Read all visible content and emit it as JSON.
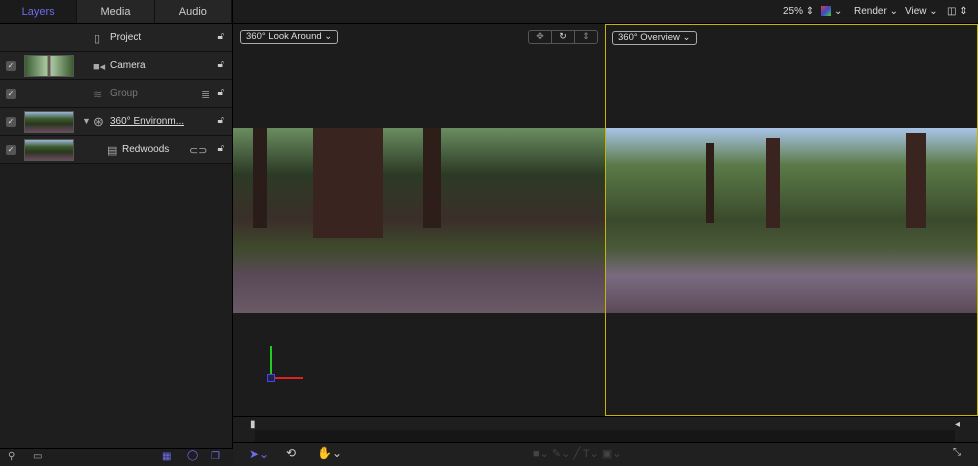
{
  "tabs": [
    "Layers",
    "Media",
    "Audio"
  ],
  "layers": [
    {
      "name": "Project",
      "icon": "document-icon"
    },
    {
      "name": "Camera",
      "icon": "camera-icon",
      "checked": true
    },
    {
      "name": "Group",
      "icon": "group-icon",
      "checked": true
    },
    {
      "name": "360° Environm...",
      "icon": "environment-icon",
      "checked": true
    },
    {
      "name": "Redwoods",
      "icon": "film-icon",
      "checked": true
    }
  ],
  "topbar": {
    "zoom": "25%",
    "render": "Render",
    "view": "View"
  },
  "viewers": {
    "left": "360° Look Around",
    "right": "360° Overview"
  },
  "colors": {
    "accent": "#6e6cf0",
    "selection": "#c8b400"
  }
}
